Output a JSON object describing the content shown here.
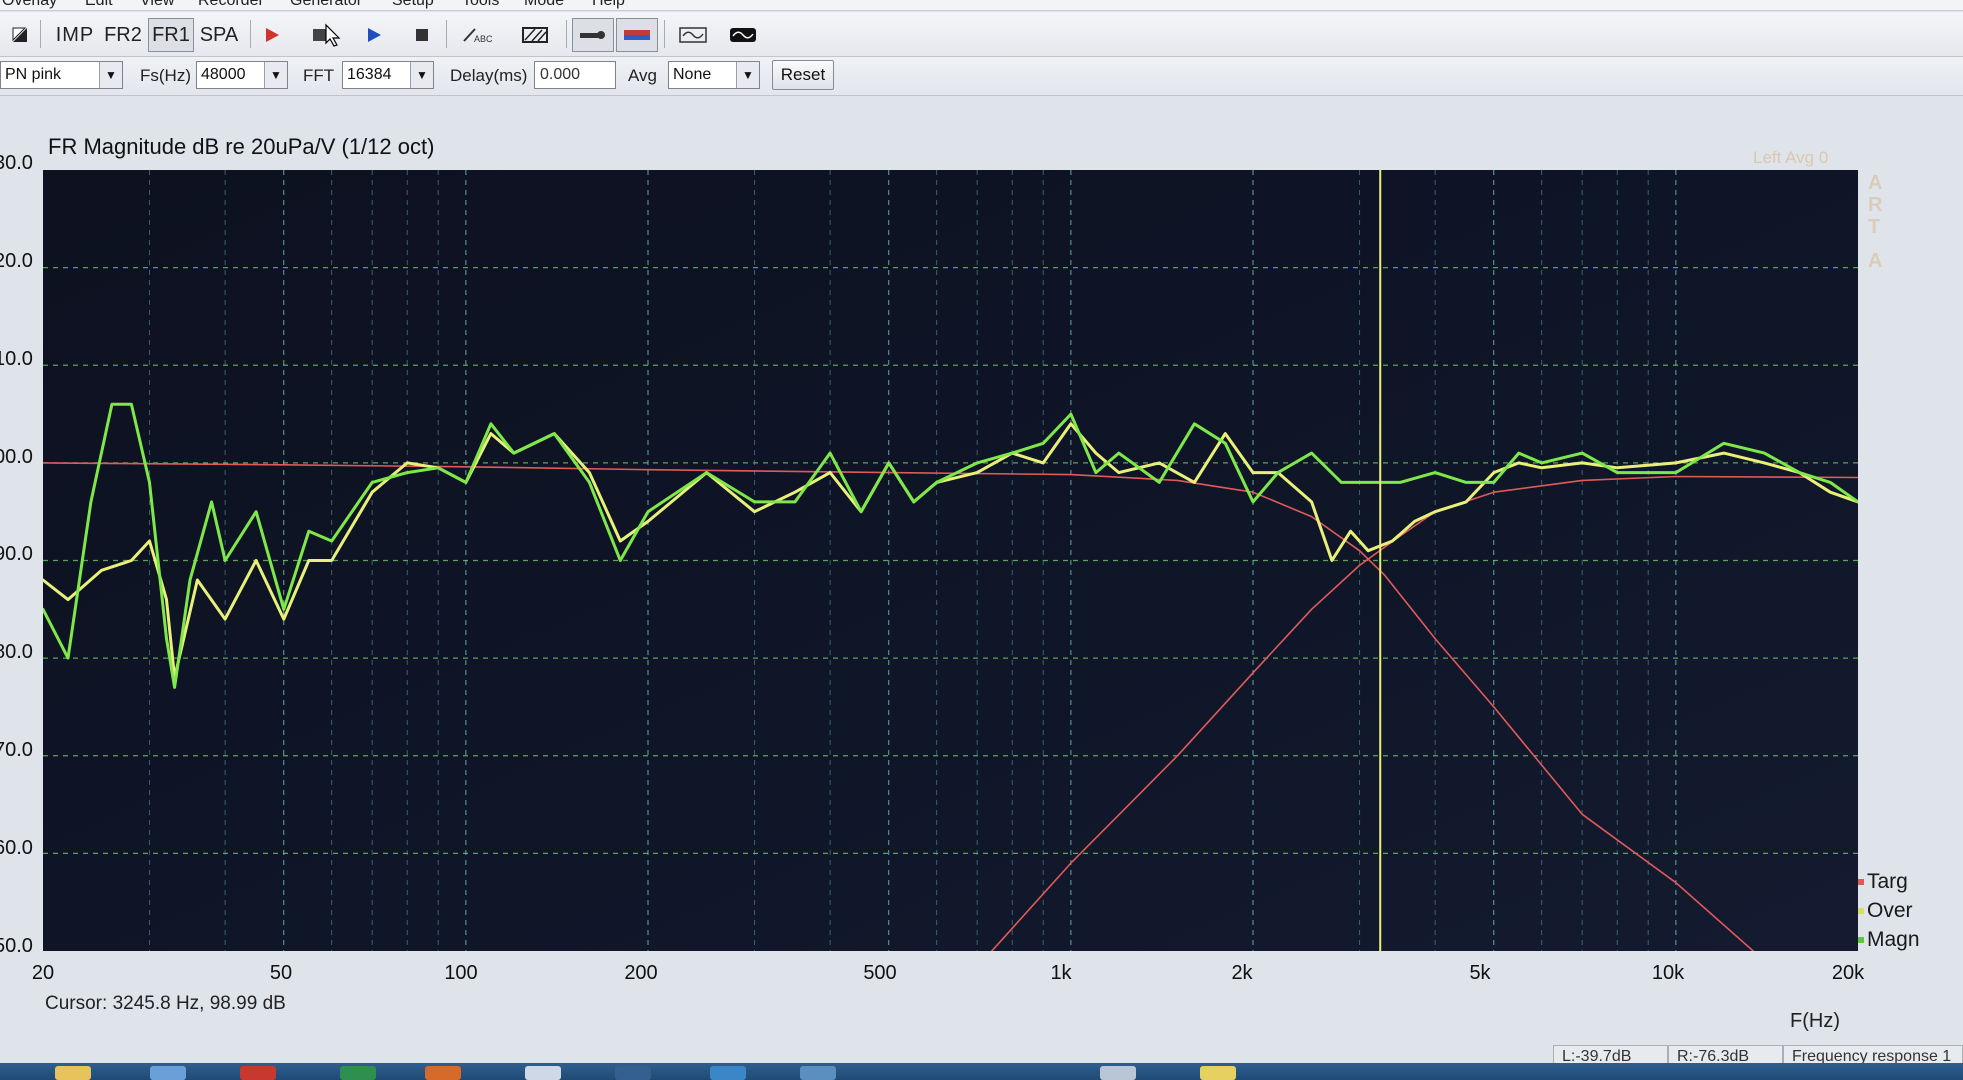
{
  "menu": [
    "Overlay",
    "Edit",
    "View",
    "Recorder",
    "Generator",
    "Setup",
    "Tools",
    "Mode",
    "Help"
  ],
  "toolbar": {
    "buttons": [
      {
        "name": "imp",
        "label": "IMP"
      },
      {
        "name": "fr2",
        "label": "FR2"
      },
      {
        "name": "fr1",
        "label": "FR1"
      },
      {
        "name": "spa",
        "label": "SPA"
      }
    ]
  },
  "controls": {
    "generator_value": "PN pink",
    "fs_label": "Fs(Hz)",
    "fs_value": "48000",
    "fft_label": "FFT",
    "fft_value": "16384",
    "delay_label": "Delay(ms)",
    "delay_value": "0.000",
    "avg_label": "Avg",
    "avg_value": "None",
    "reset_label": "Reset"
  },
  "graph": {
    "title": "FR Magnitude dB re 20uPa/V (1/12 oct)",
    "y_ticks": [
      "30.0",
      "20.0",
      "10.0",
      "00.0",
      "90.0",
      "80.0",
      "70.0",
      "60.0",
      "50.0"
    ],
    "x_ticks": [
      "20",
      "50",
      "100",
      "200",
      "500",
      "1k",
      "2k",
      "5k",
      "10k",
      "20k"
    ],
    "x_unit": "F(Hz)",
    "corner_note": "Left Avg 0",
    "watermark": [
      "A",
      "R",
      "T",
      "A"
    ],
    "legend": [
      {
        "label": "Targ",
        "color": "#e05a5a"
      },
      {
        "label": "Over",
        "color": "#e8f07a"
      },
      {
        "label": "Magn",
        "color": "#7ee84a"
      }
    ]
  },
  "cursor": {
    "text": "Cursor:  3245.8 Hz, 98.99 dB",
    "freq": 3245.8
  },
  "status": {
    "left": "L:-39.7dB",
    "right": "R:-76.3dB",
    "mode": "Frequency response 1"
  },
  "chart_data": {
    "type": "line",
    "title": "FR Magnitude dB re 20uPa/V (1/12 oct)",
    "xlabel": "F(Hz)",
    "ylabel": "",
    "xscale": "log",
    "xlim": [
      20,
      20000
    ],
    "ylim": [
      50,
      130
    ],
    "grid": true,
    "legend": "bottom-right",
    "series": [
      {
        "name": "Targ",
        "color": "#e05a5a",
        "x": [
          20,
          50,
          100,
          200,
          500,
          1000,
          1500,
          2000,
          2500,
          3000,
          3300,
          4000,
          5000,
          7000,
          10000,
          14000
        ],
        "y": [
          100,
          99.8,
          99.6,
          99.3,
          99,
          98.8,
          98.2,
          97,
          94.5,
          91,
          88.5,
          82,
          75,
          64,
          57,
          49
        ]
      },
      {
        "name": "Targ",
        "color": "#e05a5a",
        "x": [
          740,
          1000,
          1500,
          2000,
          2500,
          3000,
          3500,
          4000,
          5000,
          7000,
          10000,
          20000
        ],
        "y": [
          50,
          59,
          70,
          78.5,
          85,
          89.5,
          92.5,
          95,
          97,
          98.2,
          98.6,
          98.5
        ]
      },
      {
        "name": "Over",
        "color": "#e8f07a",
        "x": [
          20,
          22,
          25,
          28,
          30,
          32,
          33,
          36,
          40,
          45,
          50,
          55,
          60,
          70,
          80,
          90,
          100,
          110,
          120,
          140,
          160,
          180,
          200,
          250,
          300,
          350,
          400,
          450,
          500,
          550,
          600,
          700,
          800,
          900,
          1000,
          1100,
          1200,
          1400,
          1600,
          1800,
          2000,
          2200,
          2500,
          2700,
          2900,
          3100,
          3400,
          3700,
          4000,
          4500,
          5000,
          5500,
          6000,
          7000,
          8000,
          10000,
          12000,
          14000,
          16000,
          18000,
          20000
        ],
        "y": [
          88,
          86,
          89,
          90,
          92,
          86,
          78,
          88,
          84,
          90,
          84,
          90,
          90,
          97,
          100,
          99.5,
          98,
          103,
          101,
          103,
          99,
          92,
          94,
          99,
          95,
          97,
          99,
          95,
          100,
          96,
          98,
          99,
          101,
          100,
          104,
          101,
          99,
          100,
          98,
          103,
          99,
          99,
          96,
          90,
          93,
          91,
          92,
          94,
          95,
          96,
          99,
          100,
          99.5,
          100,
          99.5,
          100,
          101,
          100,
          99,
          97,
          96
        ]
      },
      {
        "name": "Magn",
        "color": "#7ee84a",
        "x": [
          20,
          22,
          24,
          26,
          28,
          30,
          32,
          33,
          35,
          38,
          40,
          45,
          50,
          55,
          60,
          70,
          80,
          90,
          100,
          110,
          120,
          140,
          160,
          180,
          200,
          250,
          300,
          350,
          400,
          450,
          500,
          550,
          600,
          700,
          800,
          900,
          1000,
          1100,
          1200,
          1400,
          1600,
          1800,
          2000,
          2200,
          2500,
          2800,
          3000,
          3500,
          4000,
          4500,
          5000,
          5500,
          6000,
          7000,
          8000,
          10000,
          12000,
          14000,
          16000,
          18000,
          20000
        ],
        "y": [
          85,
          80,
          96,
          106,
          106,
          98,
          82,
          77,
          88,
          96,
          90,
          95,
          85,
          93,
          92,
          98,
          99,
          99.5,
          98,
          104,
          101,
          103,
          98,
          90,
          95,
          99,
          96,
          96,
          101,
          95,
          100,
          96,
          98,
          100,
          101,
          102,
          105,
          99,
          101,
          98,
          104,
          102,
          96,
          99,
          101,
          98,
          98,
          98,
          99,
          98,
          98,
          101,
          100,
          101,
          99,
          99,
          102,
          101,
          99,
          98,
          96
        ]
      }
    ]
  }
}
